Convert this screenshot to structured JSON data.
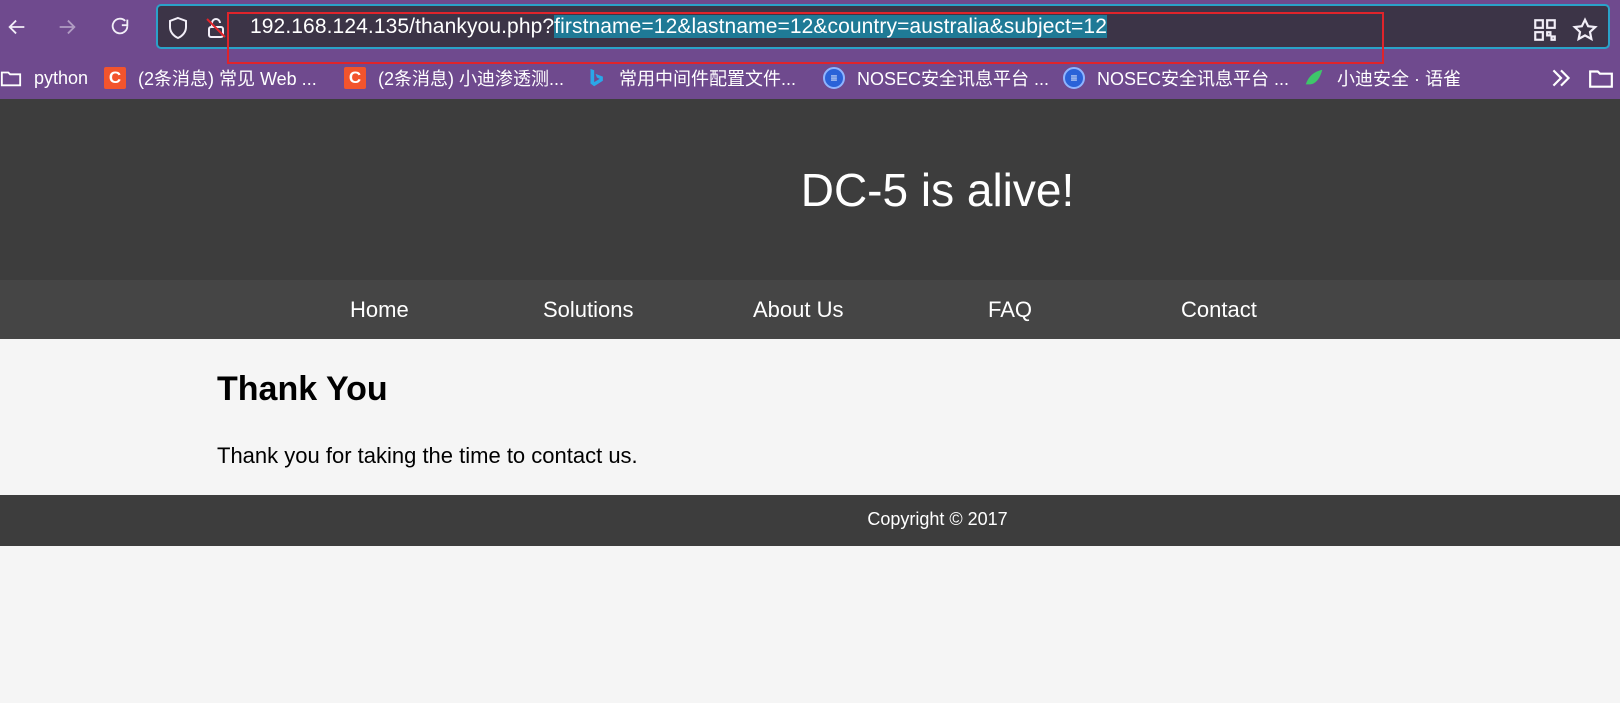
{
  "browser": {
    "url_host_path": "192.168.124.135/thankyou.php?",
    "url_query_selected": "firstname=12&lastname=12&country=australia&subject=12",
    "icons": [
      "back-icon",
      "forward-icon",
      "reload-icon",
      "shield-icon",
      "lock-warning-icon",
      "qr-code-icon",
      "star-icon",
      "chevron-double-right-icon",
      "folder-icon"
    ],
    "accent_color": "#6f4a8e",
    "highlight_color": "#e0242b"
  },
  "bookmarks": [
    {
      "label": "python",
      "icon": "folder-icon"
    },
    {
      "label": "(2条消息) 常见 Web ...",
      "icon": "csdn-icon"
    },
    {
      "label": "(2条消息) 小迪渗透测...",
      "icon": "csdn-icon"
    },
    {
      "label": "常用中间件配置文件...",
      "icon": "bing-icon"
    },
    {
      "label": "NOSEC安全讯息平台 ...",
      "icon": "nosec-icon"
    },
    {
      "label": "NOSEC安全讯息平台 ...",
      "icon": "nosec-icon"
    },
    {
      "label": "小迪安全 · 语雀",
      "icon": "yuque-icon"
    }
  ],
  "site": {
    "title": "DC-5 is alive!",
    "nav": [
      "Home",
      "Solutions",
      "About Us",
      "FAQ",
      "Contact"
    ],
    "heading": "Thank You",
    "message": "Thank you for taking the time to contact us.",
    "footer": "Copyright © 2017"
  }
}
